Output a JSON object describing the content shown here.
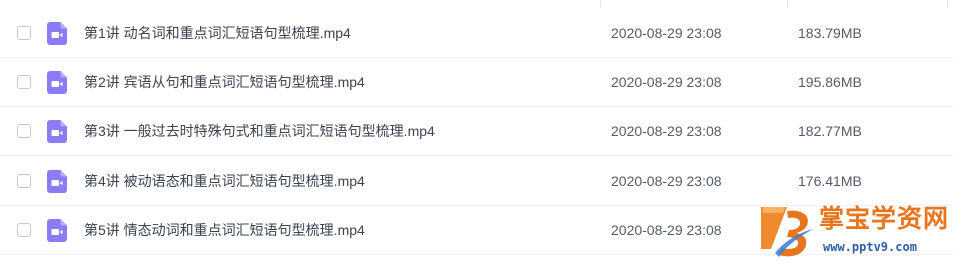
{
  "files": [
    {
      "name": "第1讲 动名词和重点词汇短语句型梳理.mp4",
      "date": "2020-08-29 23:08",
      "size": "183.79MB",
      "icon": "video-file-icon"
    },
    {
      "name": "第2讲 宾语从句和重点词汇短语句型梳理.mp4",
      "date": "2020-08-29 23:08",
      "size": "195.86MB",
      "icon": "video-file-icon"
    },
    {
      "name": "第3讲 一般过去时特殊句式和重点词汇短语句型梳理.mp4",
      "date": "2020-08-29 23:08",
      "size": "182.77MB",
      "icon": "video-file-icon"
    },
    {
      "name": "第4讲 被动语态和重点词汇短语句型梳理.mp4",
      "date": "2020-08-29 23:08",
      "size": "176.41MB",
      "icon": "video-file-icon"
    },
    {
      "name": "第5讲 情态动词和重点词汇短语句型梳理.mp4",
      "date": "2020-08-29 23:08",
      "size": "",
      "icon": "video-file-icon"
    }
  ],
  "watermark": {
    "title": "掌宝学资网",
    "url": "www.pptv9.com"
  },
  "colors": {
    "file_icon": "#8b7cf6",
    "watermark_orange": "#e8761f",
    "watermark_blue": "#2f5fa8"
  }
}
